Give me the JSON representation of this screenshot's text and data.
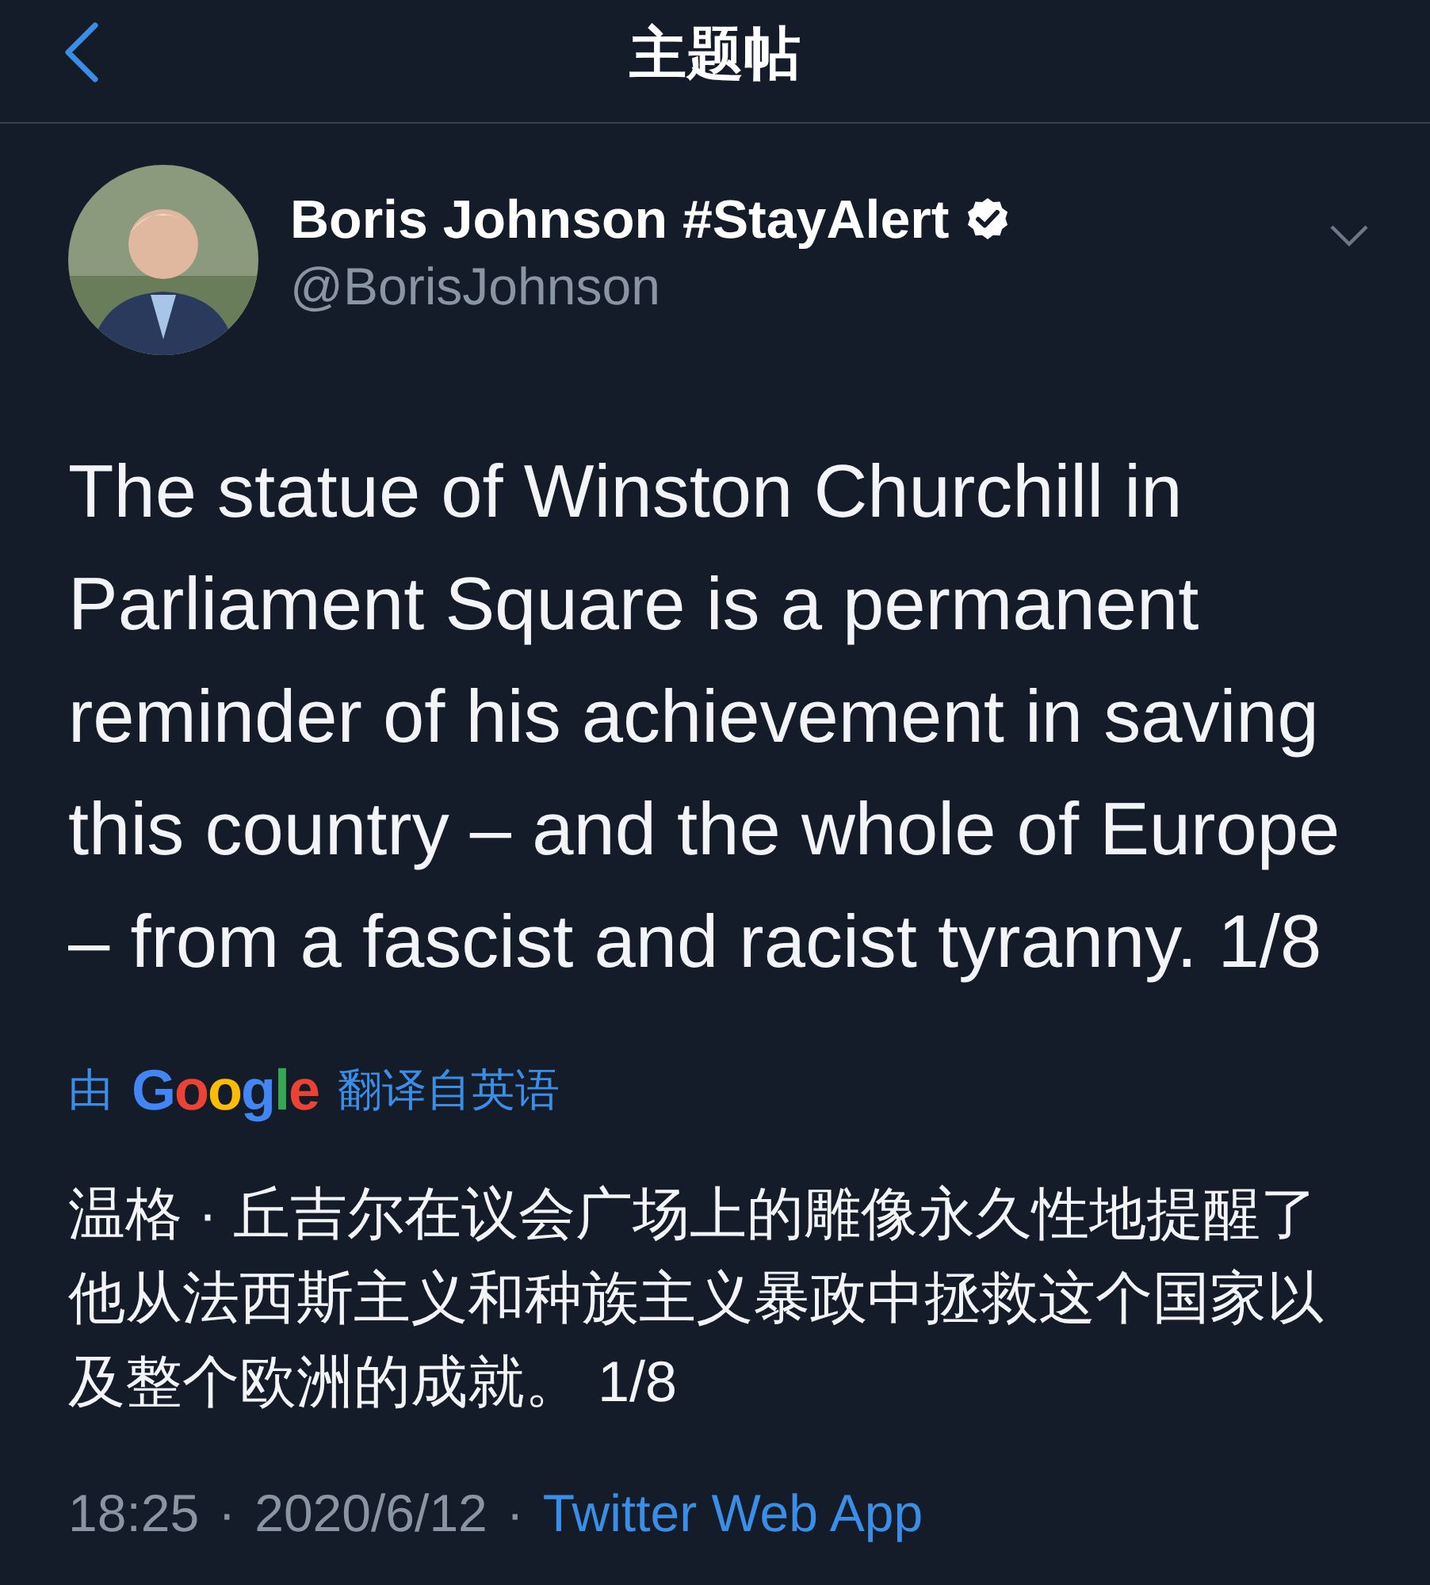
{
  "header": {
    "title": "主题帖"
  },
  "tweet": {
    "author": {
      "name": "Boris Johnson #StayAlert",
      "verified": true,
      "handle": "@BorisJohnson"
    },
    "text": "The statue of Winston Churchill in Parliament Square is a permanent reminder of his achievement in saving this country – and the whole of Europe – from a fascist and racist tyranny. 1/8",
    "translation": {
      "prefix": "由",
      "provider": "Google",
      "suffix": "翻译自英语",
      "text": "温格 · 丘吉尔在议会广场上的雕像永久性地提醒了他从法西斯主义和种族主义暴政中拯救这个国家以及整个欧洲的成就。 1/8"
    },
    "meta": {
      "time": "18:25",
      "separator_1": "·",
      "date": "2020/6/12",
      "separator_2": "·",
      "source": "Twitter Web App"
    }
  }
}
